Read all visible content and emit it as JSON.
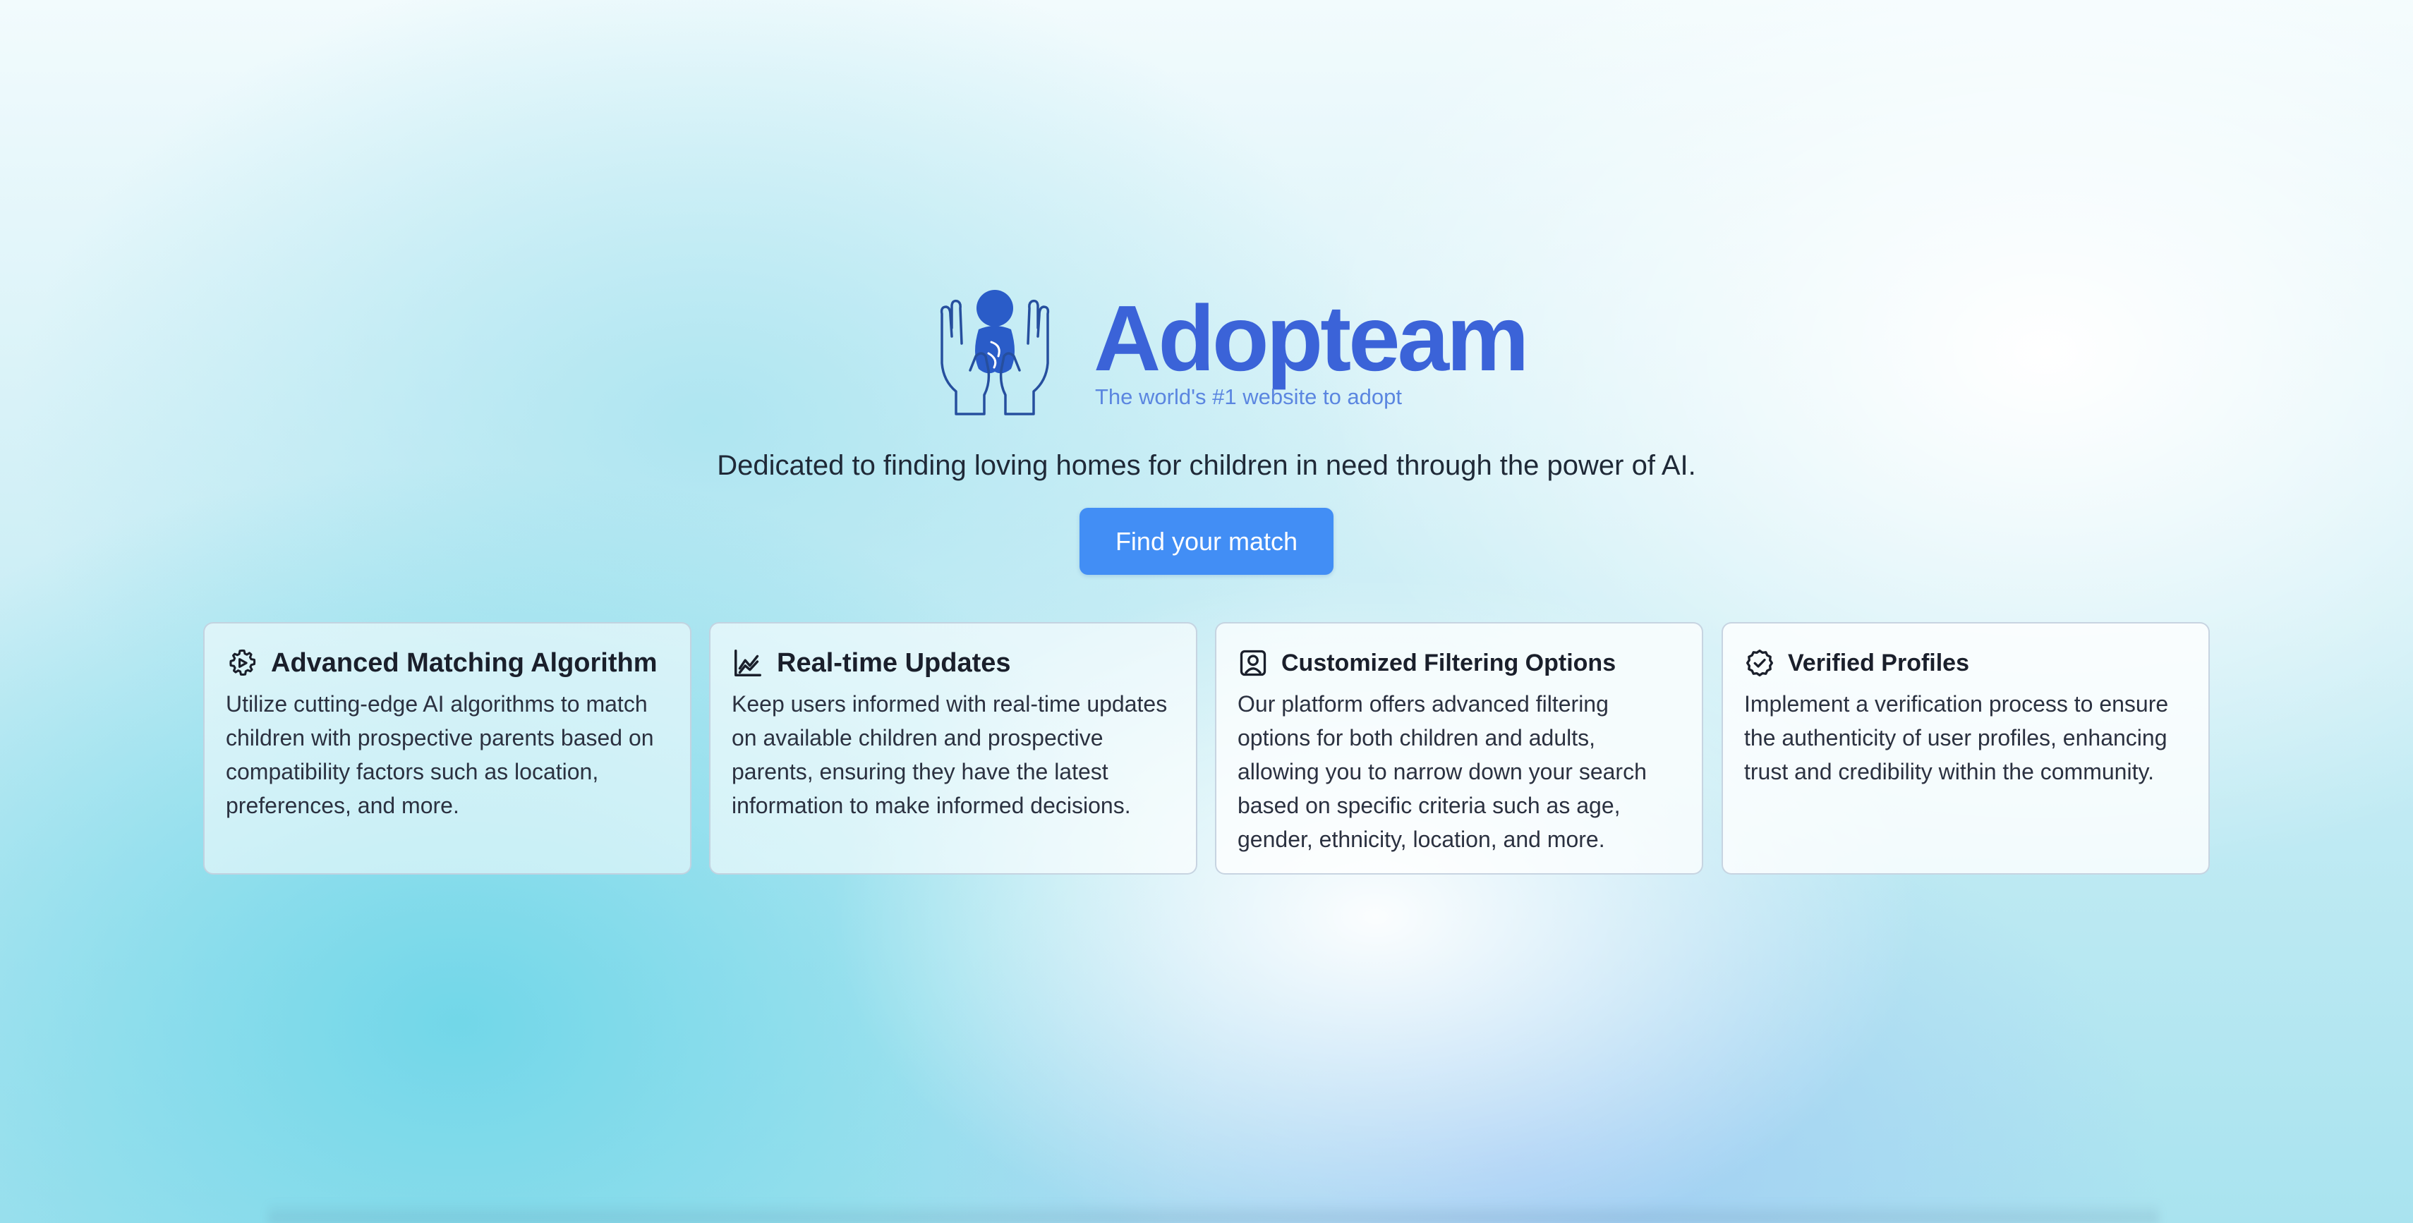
{
  "brand": {
    "name": "Adopteam",
    "tagline": "The world's #1 website to adopt",
    "accent_color": "#3b63d8",
    "logo_icon": "hands-holding-child-icon"
  },
  "hero": {
    "mission": "Dedicated to finding loving homes for children in need through the power of AI.",
    "cta_label": "Find your match",
    "cta_color": "#428ef5"
  },
  "features": [
    {
      "icon": "gear-icon",
      "title": "Advanced Matching Algorithm",
      "body": "Utilize cutting-edge AI algorithms to match children with prospective parents based on compatibility factors such as location, preferences, and more."
    },
    {
      "icon": "line-chart-icon",
      "title": "Real-time Updates",
      "body": "Keep users informed with real-time updates on available children and prospective parents, ensuring they have the latest information to make informed decisions."
    },
    {
      "icon": "user-square-icon",
      "title": "Customized Filtering Options",
      "body": "Our platform offers advanced filtering options for both children and adults, allowing you to narrow down your search based on specific criteria such as age, gender, ethnicity, location, and more."
    },
    {
      "icon": "badge-check-icon",
      "title": "Verified Profiles",
      "body": "Implement a verification process to ensure the authenticity of user profiles, enhancing trust and credibility within the community."
    }
  ]
}
